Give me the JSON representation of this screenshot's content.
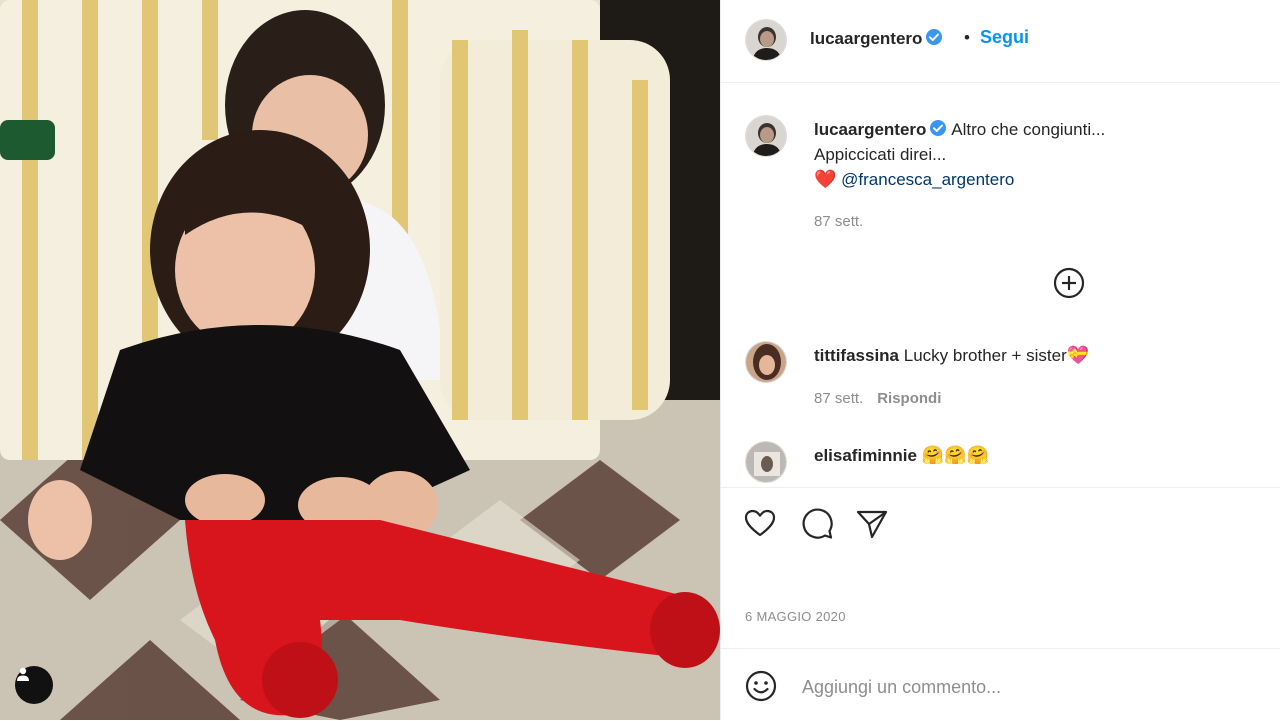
{
  "post": {
    "author": "lucaargentero",
    "follow_label": "Segui",
    "separator": "•",
    "caption": {
      "author": "lucaargentero",
      "line1": "Altro che congiunti...",
      "line2": "Appiccicati direi...",
      "heart": "❤️",
      "mention": "@francesca_argentero",
      "age": "87 sett."
    },
    "comments": [
      {
        "user": "tittifassina",
        "text": "Lucky brother + sister",
        "emoji": "💝",
        "age": "87 sett.",
        "reply_label": "Rispondi"
      },
      {
        "user": "elisafiminnie",
        "text": "",
        "emoji": "🤗🤗🤗",
        "age": "",
        "reply_label": ""
      }
    ],
    "date": "6 MAGGIO 2020",
    "comment_placeholder": "Aggiungi un commento..."
  },
  "icons": {
    "verified": "verified-badge-icon",
    "load_more": "plus-circle-icon",
    "like": "heart-icon",
    "comment": "comment-bubble-icon",
    "share": "paper-plane-icon",
    "emoji": "smiley-icon",
    "tags": "user-tag-icon"
  },
  "colors": {
    "link_blue": "#0095f6",
    "mention": "#00376b",
    "muted": "#8e8e8e",
    "heart_red": "#e0142a"
  }
}
